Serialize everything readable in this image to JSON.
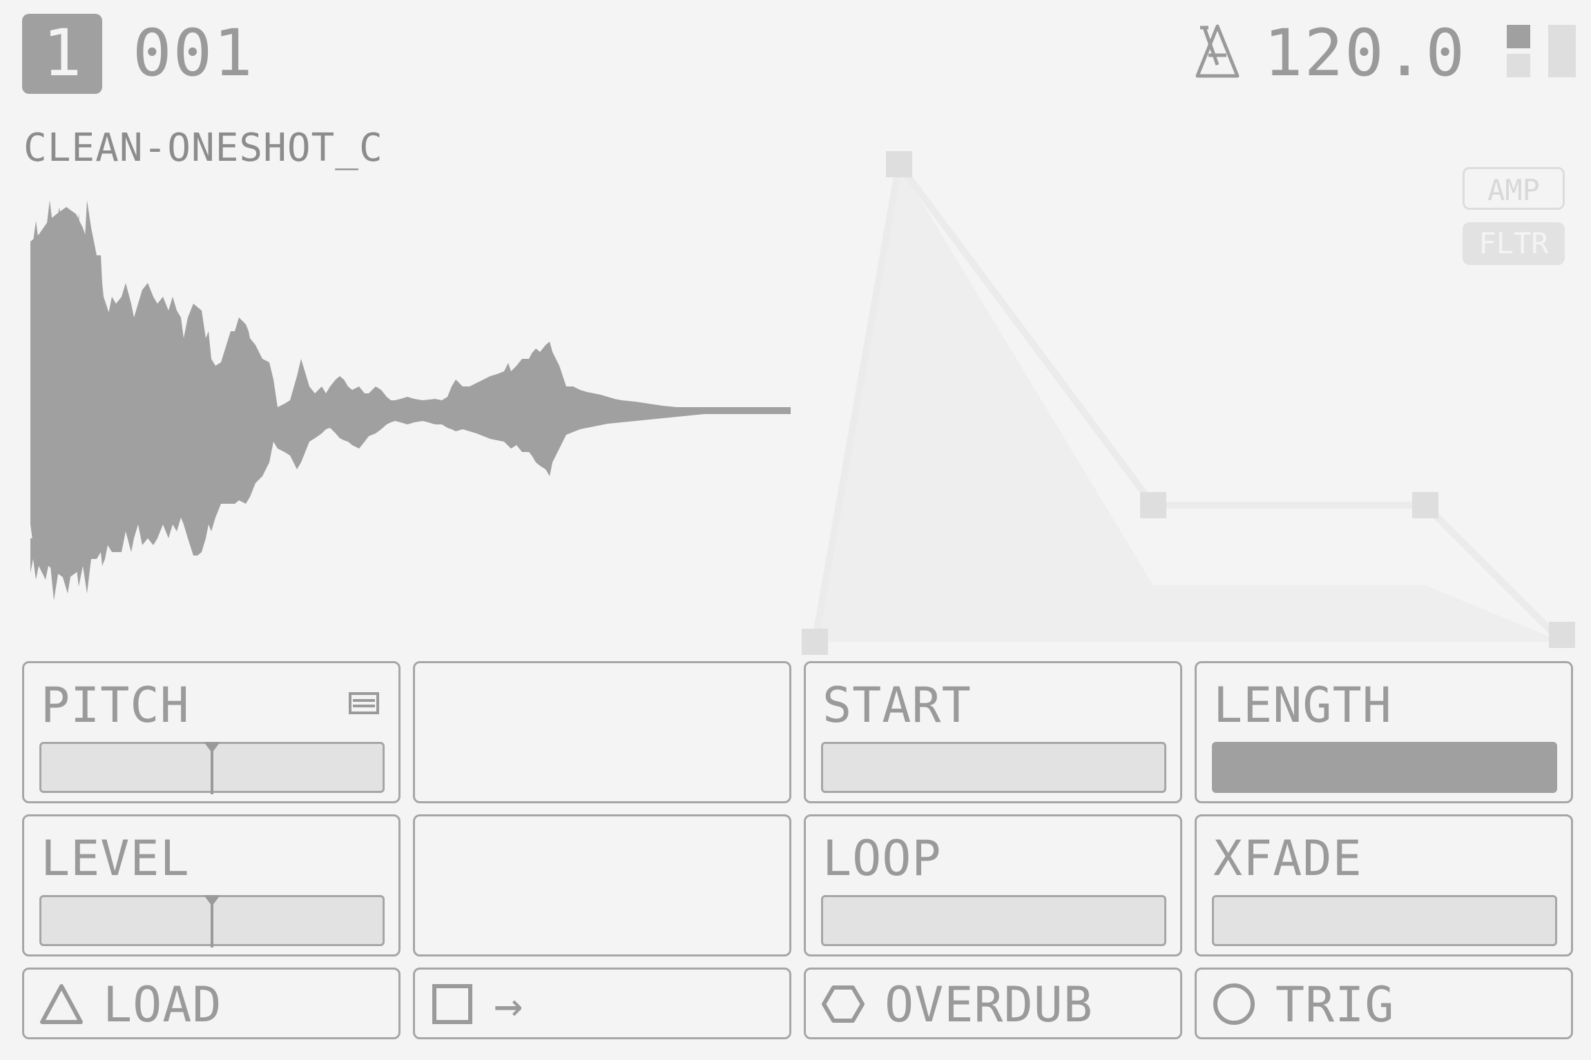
{
  "header": {
    "track_number": "1",
    "slot_number": "001",
    "bpm": "120.0",
    "metronome_icon": "metronome-icon"
  },
  "sample": {
    "name": "CLEAN-ONESHOT_C"
  },
  "envelope": {
    "tabs": [
      {
        "label": "AMP",
        "active": false
      },
      {
        "label": "FLTR",
        "active": true
      }
    ]
  },
  "params": [
    {
      "label": "PITCH",
      "icon": "list-icon",
      "slider_value": 0.5,
      "bipolar": true
    },
    {
      "label": "",
      "empty": true
    },
    {
      "label": "START",
      "slider_value": 0.0
    },
    {
      "label": "LENGTH",
      "slider_value": 1.0
    },
    {
      "label": "LEVEL",
      "slider_value": 0.5,
      "bipolar": true
    },
    {
      "label": "",
      "empty": true
    },
    {
      "label": "LOOP",
      "slider_value": 0.0
    },
    {
      "label": "XFADE",
      "slider_value": 0.0
    }
  ],
  "buttons": [
    {
      "label": "LOAD",
      "icon": "triangle-icon"
    },
    {
      "label": "→",
      "icon": "square-icon"
    },
    {
      "label": "OVERDUB",
      "icon": "hexagon-icon"
    },
    {
      "label": "TRIG",
      "icon": "circle-icon"
    }
  ],
  "colors": {
    "background": "#f4f4f4",
    "foreground": "#a0a0a0",
    "inactive": "#e2e2e2"
  }
}
